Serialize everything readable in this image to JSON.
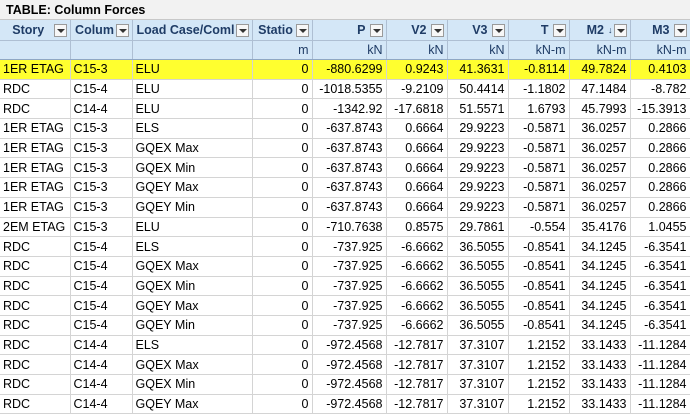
{
  "table_title": "TABLE:  Column Forces",
  "headers": [
    "Story",
    "Colum",
    "Load Case/Coml",
    "Statio",
    "P",
    "V2",
    "V3",
    "T",
    "M2",
    "M3"
  ],
  "sort_indicator": "↓",
  "units": [
    "",
    "",
    "",
    "m",
    "kN",
    "kN",
    "kN",
    "kN-m",
    "kN-m",
    "kN-m"
  ],
  "highlight_color": "#ffff2f",
  "rows": [
    [
      "1ER ETAG",
      "C15-3",
      "ELU",
      "0",
      "-880.6299",
      "0.9243",
      "41.3631",
      "-0.8114",
      "49.7824",
      "0.4103"
    ],
    [
      "RDC",
      "C15-4",
      "ELU",
      "0",
      "-1018.5355",
      "-9.2109",
      "50.4414",
      "-1.1802",
      "47.1484",
      "-8.782"
    ],
    [
      "RDC",
      "C14-4",
      "ELU",
      "0",
      "-1342.92",
      "-17.6818",
      "51.5571",
      "1.6793",
      "45.7993",
      "-15.3913"
    ],
    [
      "1ER ETAG",
      "C15-3",
      "ELS",
      "0",
      "-637.8743",
      "0.6664",
      "29.9223",
      "-0.5871",
      "36.0257",
      "0.2866"
    ],
    [
      "1ER ETAG",
      "C15-3",
      "GQEX Max",
      "0",
      "-637.8743",
      "0.6664",
      "29.9223",
      "-0.5871",
      "36.0257",
      "0.2866"
    ],
    [
      "1ER ETAG",
      "C15-3",
      "GQEX Min",
      "0",
      "-637.8743",
      "0.6664",
      "29.9223",
      "-0.5871",
      "36.0257",
      "0.2866"
    ],
    [
      "1ER ETAG",
      "C15-3",
      "GQEY Max",
      "0",
      "-637.8743",
      "0.6664",
      "29.9223",
      "-0.5871",
      "36.0257",
      "0.2866"
    ],
    [
      "1ER ETAG",
      "C15-3",
      "GQEY Min",
      "0",
      "-637.8743",
      "0.6664",
      "29.9223",
      "-0.5871",
      "36.0257",
      "0.2866"
    ],
    [
      "2EM ETAG",
      "C15-3",
      "ELU",
      "0",
      "-710.7638",
      "0.8575",
      "29.7861",
      "-0.554",
      "35.4176",
      "1.0455"
    ],
    [
      "RDC",
      "C15-4",
      "ELS",
      "0",
      "-737.925",
      "-6.6662",
      "36.5055",
      "-0.8541",
      "34.1245",
      "-6.3541"
    ],
    [
      "RDC",
      "C15-4",
      "GQEX Max",
      "0",
      "-737.925",
      "-6.6662",
      "36.5055",
      "-0.8541",
      "34.1245",
      "-6.3541"
    ],
    [
      "RDC",
      "C15-4",
      "GQEX Min",
      "0",
      "-737.925",
      "-6.6662",
      "36.5055",
      "-0.8541",
      "34.1245",
      "-6.3541"
    ],
    [
      "RDC",
      "C15-4",
      "GQEY Max",
      "0",
      "-737.925",
      "-6.6662",
      "36.5055",
      "-0.8541",
      "34.1245",
      "-6.3541"
    ],
    [
      "RDC",
      "C15-4",
      "GQEY Min",
      "0",
      "-737.925",
      "-6.6662",
      "36.5055",
      "-0.8541",
      "34.1245",
      "-6.3541"
    ],
    [
      "RDC",
      "C14-4",
      "ELS",
      "0",
      "-972.4568",
      "-12.7817",
      "37.3107",
      "1.2152",
      "33.1433",
      "-11.1284"
    ],
    [
      "RDC",
      "C14-4",
      "GQEX Max",
      "0",
      "-972.4568",
      "-12.7817",
      "37.3107",
      "1.2152",
      "33.1433",
      "-11.1284"
    ],
    [
      "RDC",
      "C14-4",
      "GQEX Min",
      "0",
      "-972.4568",
      "-12.7817",
      "37.3107",
      "1.2152",
      "33.1433",
      "-11.1284"
    ],
    [
      "RDC",
      "C14-4",
      "GQEY Max",
      "0",
      "-972.4568",
      "-12.7817",
      "37.3107",
      "1.2152",
      "33.1433",
      "-11.1284"
    ]
  ]
}
